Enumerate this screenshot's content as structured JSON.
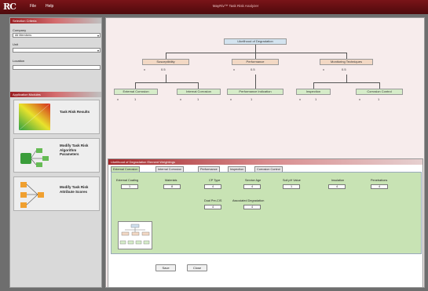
{
  "app": {
    "title": "MayRiv™ Task Risk Analyzer",
    "logo": "RC",
    "menu": [
      "File",
      "Help"
    ]
  },
  "sidebar": {
    "panel_title": "Selection Criteria",
    "fields": [
      {
        "label": "Company",
        "value": "All Members"
      },
      {
        "label": "Unit",
        "value": ""
      },
      {
        "label": "Location",
        "value": ""
      }
    ],
    "panel2_title": "Application Modules",
    "cards": [
      {
        "label": "Task Risk Results"
      },
      {
        "label": "Modify Task Risk Algorithm Parameters"
      },
      {
        "label": "Modify Task Risk Attribute Scores"
      }
    ]
  },
  "tree": {
    "root": "Likelihood of Degradation",
    "children": [
      {
        "label": "Susceptibility",
        "sign": "x",
        "value": "0.5",
        "children": [
          {
            "label": "External Corrosion",
            "sign": "x",
            "value": "1"
          },
          {
            "label": "Internal Corrosion",
            "sign": "x",
            "value": "1"
          }
        ]
      },
      {
        "label": "Performance",
        "sign": "x",
        "value": "0.5",
        "children": [
          {
            "label": "Performance Indication",
            "sign": "x",
            "value": "1"
          }
        ]
      },
      {
        "label": "Monitoring Techniques",
        "sign": "x",
        "value": "0.5",
        "children": [
          {
            "label": "Inspection",
            "sign": "x",
            "value": "1"
          },
          {
            "label": "Corrosion Control",
            "sign": "x",
            "value": "1"
          }
        ]
      }
    ]
  },
  "lower": {
    "title": "Likelihood of Degradation Element Weightings",
    "tabs": [
      "External Corrosion",
      "Internal Corrosion",
      "Performance",
      "Inspection",
      "Corrosion Control"
    ],
    "fields_row1": [
      {
        "label": "External Coating",
        "value": "1"
      },
      {
        "label": "Materials",
        "value": "8"
      },
      {
        "label": "CP Type",
        "value": "4"
      },
      {
        "label": "Service Age",
        "value": "4"
      },
      {
        "label": "Soil pH Value",
        "value": "1"
      },
      {
        "label": "Insulation",
        "value": "4"
      },
      {
        "label": "Penetrations",
        "value": "4"
      }
    ],
    "fields_row2": [
      {
        "label": "Dual Pre-CIS",
        "value": "4"
      },
      {
        "label": "Associated Degradation",
        "value": "4"
      }
    ],
    "save_label": "Save",
    "close_label": "Close"
  },
  "colors": {
    "accent": "#8c1a1e",
    "tab_body": "#c8e3b4",
    "root_node": "#d3e3ef",
    "level1_node": "#f2d8c4",
    "level2_node": "#d6ecc9"
  }
}
